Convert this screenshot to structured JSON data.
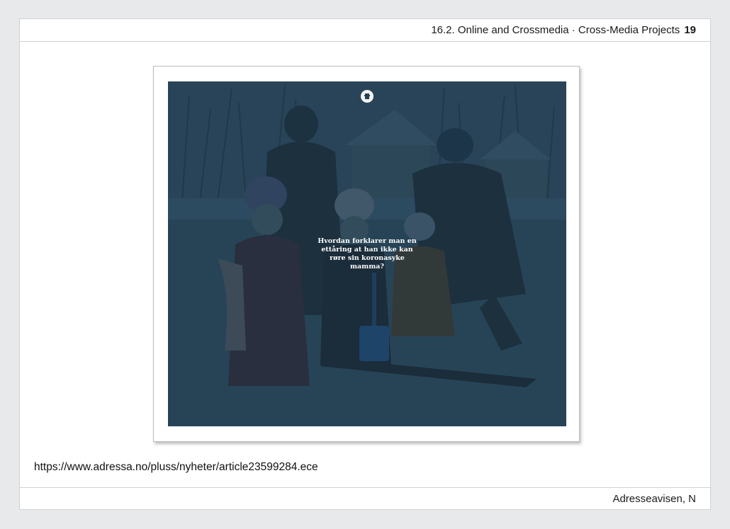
{
  "header": {
    "title": "16.2. Online and Crossmedia · Cross-Media Projects",
    "page_number": "19"
  },
  "figure": {
    "headline": "Hvordan forklarer man en ettåring at han ikke kan røre sin koronasyke mamma?",
    "logo_icon": "adressa-crest-icon",
    "overlay_color": "#253f52"
  },
  "url": "https://www.adressa.no/pluss/nyheter/article23599284.ece",
  "footer": {
    "source": "Adresseavisen, N"
  }
}
